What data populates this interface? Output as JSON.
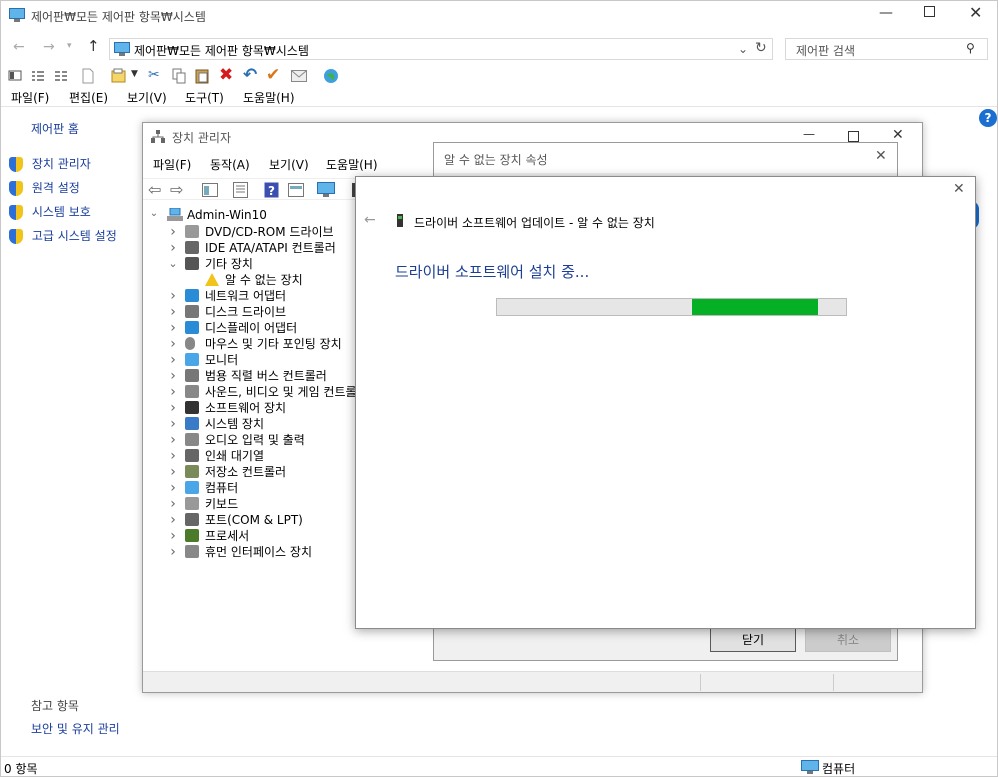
{
  "main_window": {
    "title": "제어판₩모든 제어판 항목₩시스템",
    "address": "제어판₩모든 제어판 항목₩시스템",
    "search_placeholder": "제어판 검색",
    "menu": [
      "파일(F)",
      "편집(E)",
      "보기(V)",
      "도구(T)",
      "도움말(H)"
    ],
    "sidebar_home": "제어판 홈",
    "sidebar_items": [
      "장치 관리자",
      "원격 설정",
      "시스템 보호",
      "고급 시스템 설정"
    ],
    "see_also_header": "참고 항목",
    "see_also_item": "보안 및 유지 관리",
    "status_left": "0 항목",
    "status_right": "컴퓨터",
    "help_symbol": "?"
  },
  "device_manager": {
    "title": "장치 관리자",
    "menu": [
      "파일(F)",
      "동작(A)",
      "보기(V)",
      "도움말(H)"
    ],
    "root": "Admin-Win10",
    "items": [
      {
        "label": "DVD/CD-ROM 드라이브",
        "icon": "dvd-drive-icon",
        "expanded": false
      },
      {
        "label": "IDE ATA/ATAPI 컨트롤러",
        "icon": "ide-controller-icon",
        "expanded": false
      },
      {
        "label": "기타 장치",
        "icon": "other-devices-icon",
        "expanded": true
      },
      {
        "label": "알 수 없는 장치",
        "icon": "unknown-device-warning-icon",
        "child": true
      },
      {
        "label": "네트워크 어댑터",
        "icon": "network-adapter-icon",
        "expanded": false
      },
      {
        "label": "디스크 드라이브",
        "icon": "disk-drive-icon",
        "expanded": false
      },
      {
        "label": "디스플레이 어댑터",
        "icon": "display-adapter-icon",
        "expanded": false
      },
      {
        "label": "마우스 및 기타 포인팅 장치",
        "icon": "mouse-icon",
        "expanded": false
      },
      {
        "label": "모니터",
        "icon": "monitor-icon",
        "expanded": false
      },
      {
        "label": "범용 직렬 버스 컨트롤러",
        "icon": "usb-icon",
        "expanded": false
      },
      {
        "label": "사운드, 비디오 및 게임 컨트롤러",
        "icon": "sound-icon",
        "expanded": false
      },
      {
        "label": "소프트웨어 장치",
        "icon": "software-device-icon",
        "expanded": false
      },
      {
        "label": "시스템 장치",
        "icon": "system-device-icon",
        "expanded": false
      },
      {
        "label": "오디오 입력 및 출력",
        "icon": "audio-io-icon",
        "expanded": false
      },
      {
        "label": "인쇄 대기열",
        "icon": "printer-icon",
        "expanded": false
      },
      {
        "label": "저장소 컨트롤러",
        "icon": "storage-controller-icon",
        "expanded": false
      },
      {
        "label": "컴퓨터",
        "icon": "computer-icon",
        "expanded": false
      },
      {
        "label": "키보드",
        "icon": "keyboard-icon",
        "expanded": false
      },
      {
        "label": "포트(COM & LPT)",
        "icon": "port-icon",
        "expanded": false
      },
      {
        "label": "프로세서",
        "icon": "processor-icon",
        "expanded": false
      },
      {
        "label": "휴먼 인터페이스 장치",
        "icon": "hid-icon",
        "expanded": false
      }
    ]
  },
  "properties": {
    "title": "알 수 없는 장치 속성",
    "close_label": "닫기",
    "cancel_label": "취소"
  },
  "update_driver": {
    "header": "드라이버 소프트웨어 업데이트 - 알 수 없는 장치",
    "status": "드라이버 소프트웨어 설치 중...",
    "progress_fraction": 0.36,
    "progress_color": "#06b025"
  }
}
